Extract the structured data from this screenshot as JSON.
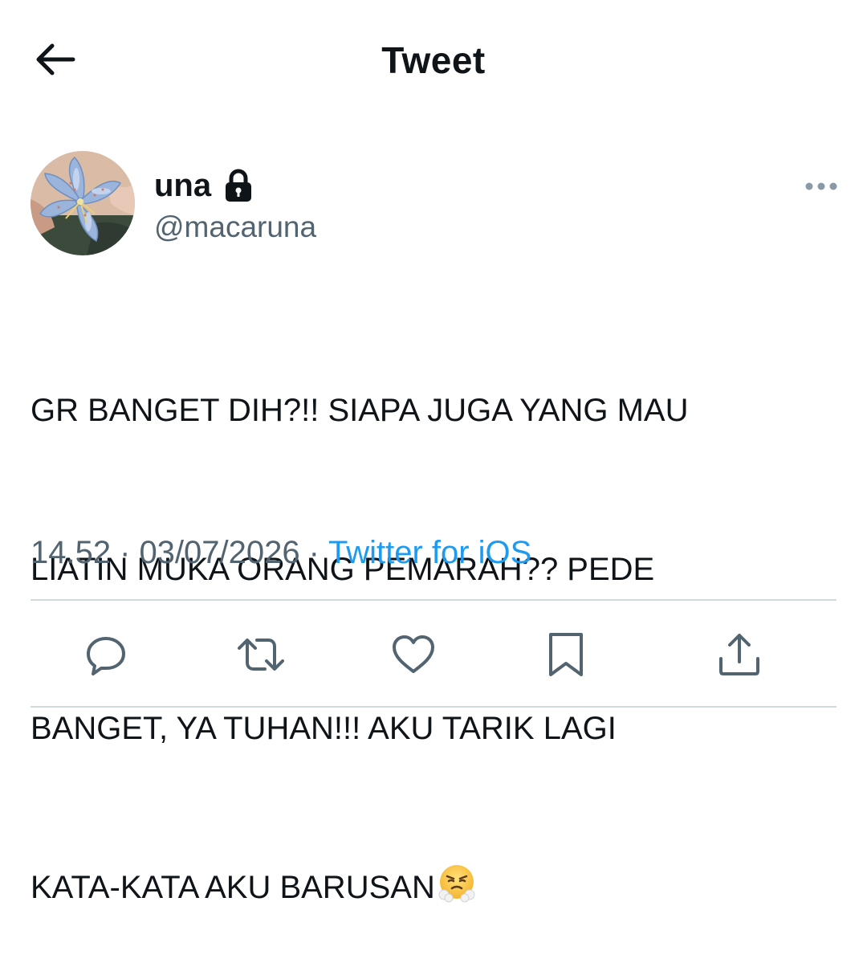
{
  "header": {
    "title": "Tweet",
    "back_icon": "arrow-left-icon"
  },
  "author": {
    "display_name": "una",
    "handle": "@macaruna",
    "protected_icon": "lock-icon",
    "avatar": "blue lily flower avatar"
  },
  "more_icon": "more-horizontal-icon",
  "tweet": {
    "lines": [
      "GR BANGET DIH?!! SIAPA JUGA YANG MAU",
      "LIATIN MUKA ORANG PEMARAH?? PEDE",
      "BANGET, YA TUHAN!!! AKU TARIK LAGI",
      "KATA-KATA AKU BARUSAN"
    ],
    "emoji": "face-with-steam-from-nose-emoji"
  },
  "meta": {
    "time": "14.52",
    "separator": "·",
    "date": "03/07/2026",
    "source": "Twitter for iOS"
  },
  "actions": {
    "icons": [
      "reply-icon",
      "retweet-icon",
      "like-icon",
      "bookmark-icon",
      "share-icon"
    ]
  },
  "colors": {
    "text_primary": "#0f1419",
    "text_secondary": "#536471",
    "accent": "#1d9bf0",
    "divider": "#cfd9de"
  }
}
